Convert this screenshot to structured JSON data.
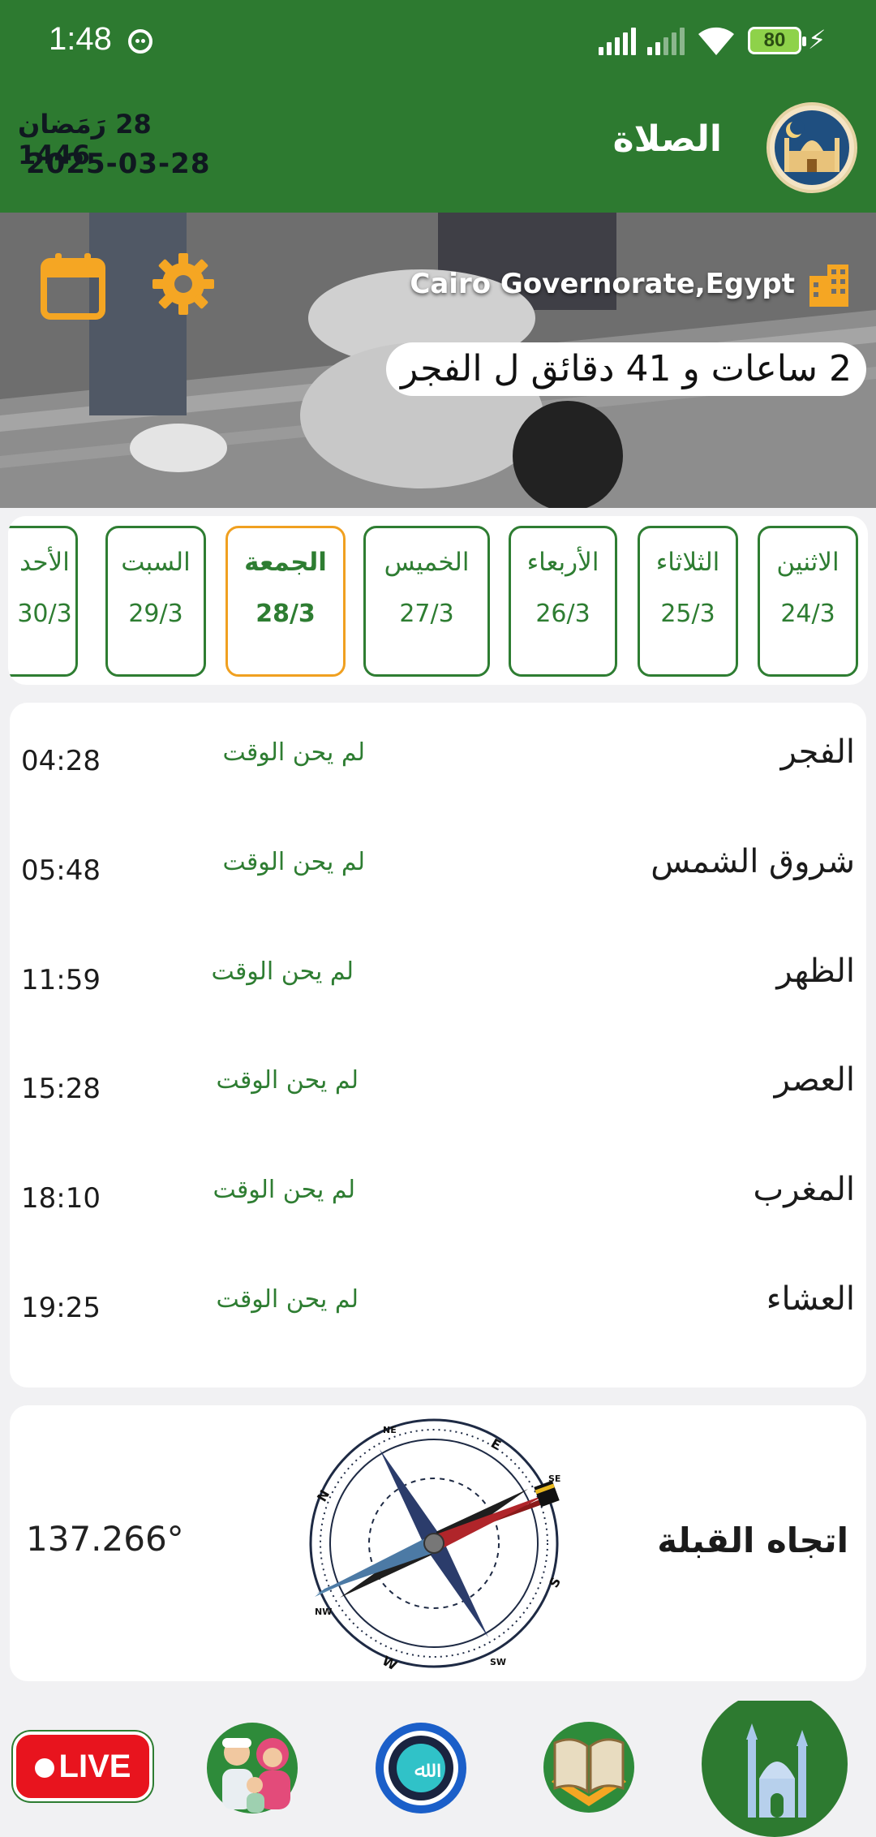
{
  "status_bar": {
    "time": "1:48",
    "battery": "80"
  },
  "header": {
    "hijri_date": "28 رَمَضان 1446",
    "gregorian_date": "2025-03-28",
    "title": "الصلاة"
  },
  "hero": {
    "location": "Cairo Governorate,Egypt",
    "countdown": "2 ساعات و 41 دقائق ل الفجر"
  },
  "days": [
    {
      "name": "الاثنين",
      "date": "24/3",
      "selected": false
    },
    {
      "name": "الثلاثاء",
      "date": "25/3",
      "selected": false
    },
    {
      "name": "الأربعاء",
      "date": "26/3",
      "selected": false
    },
    {
      "name": "الخميس",
      "date": "27/3",
      "selected": false
    },
    {
      "name": "الجمعة",
      "date": "28/3",
      "selected": true
    },
    {
      "name": "السبت",
      "date": "29/3",
      "selected": false
    },
    {
      "name": "الأحد",
      "date": "30/3",
      "selected": false
    }
  ],
  "prayers": [
    {
      "name": "الفجر",
      "status": "لم يحن الوقت",
      "time": "04:28"
    },
    {
      "name": "شروق الشمس",
      "status": "لم يحن الوقت",
      "time": "05:48"
    },
    {
      "name": "الظهر",
      "status": "لم يحن الوقت",
      "time": "11:59"
    },
    {
      "name": "العصر",
      "status": "لم يحن الوقت",
      "time": "15:28"
    },
    {
      "name": "المغرب",
      "status": "لم يحن الوقت",
      "time": "18:10"
    },
    {
      "name": "العشاء",
      "status": "لم يحن الوقت",
      "time": "19:25"
    }
  ],
  "qibla": {
    "title": "اتجاه القبلة",
    "angle": "137.266°",
    "compass_labels": {
      "n": "N",
      "ne": "NE",
      "e": "E",
      "se": "SE",
      "s": "S",
      "sw": "SW",
      "w": "W",
      "nw": "NW"
    }
  },
  "bottom_nav": {
    "live_label": "LIVE",
    "items": [
      "live-icon",
      "family-icon",
      "allah-icon",
      "quran-icon",
      "mosque-icon"
    ]
  },
  "colors": {
    "primary_green": "#2d7a30",
    "accent_orange": "#f0a020",
    "status_green": "#2e7d32"
  }
}
